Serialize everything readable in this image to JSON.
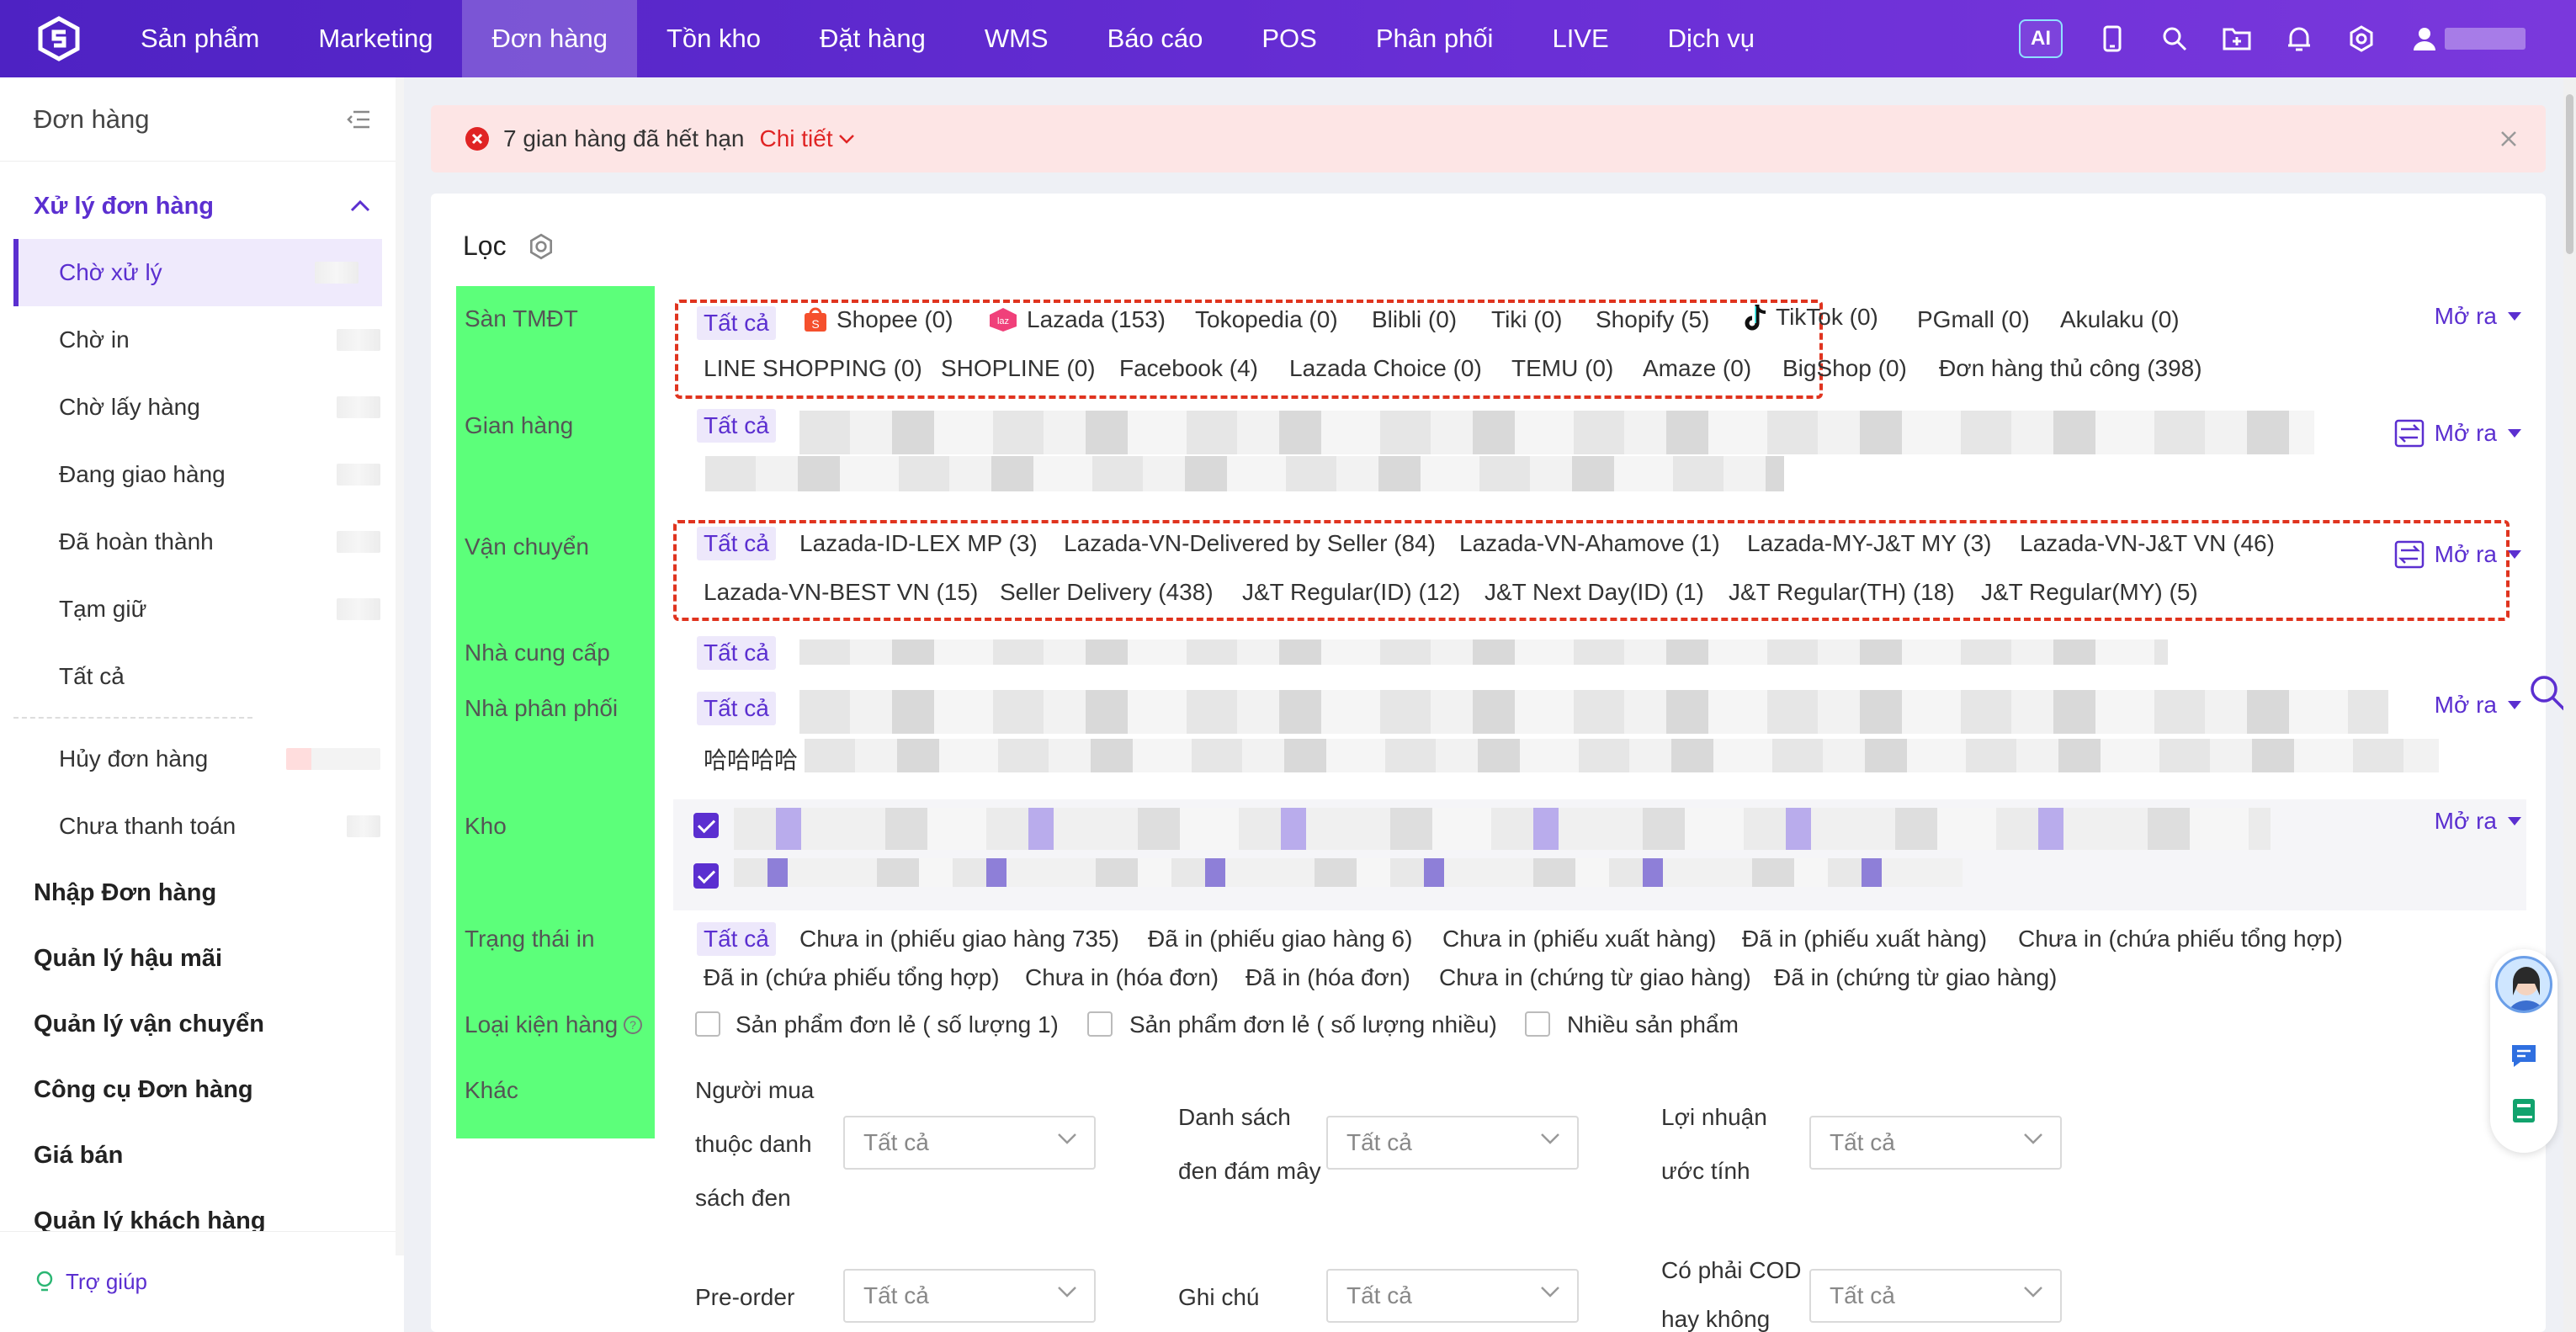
{
  "nav": {
    "items": [
      "Sản phẩm",
      "Marketing",
      "Đơn hàng",
      "Tồn kho",
      "Đặt hàng",
      "WMS",
      "Báo cáo",
      "POS",
      "Phân phối",
      "LIVE",
      "Dịch vụ"
    ],
    "active_index": 2,
    "ai_label": "AI",
    "icons": [
      "mobile-icon",
      "search-icon",
      "folder-icon",
      "bell-icon",
      "gear-icon",
      "user-icon"
    ]
  },
  "sidebar": {
    "title": "Đơn hàng",
    "group_open": "Xử lý đơn hàng",
    "items": [
      "Chờ xử lý",
      "Chờ in",
      "Chờ lấy hàng",
      "Đang giao hàng",
      "Đã hoàn thành",
      "Tạm giữ",
      "Tất cả"
    ],
    "items2": [
      "Hủy đơn hàng",
      "Chưa thanh toán"
    ],
    "groups": [
      "Nhập Đơn hàng",
      "Quản lý hậu mãi",
      "Quản lý vận chuyển",
      "Công cụ Đơn hàng",
      "Giá bán",
      "Quản lý khách hàng"
    ],
    "help": "Trợ giúp"
  },
  "alert": {
    "text": "7 gian hàng đã hết hạn",
    "link": "Chi tiết"
  },
  "filter": {
    "title": "Lọc",
    "expand": "Mở ra",
    "all": "Tất cả",
    "labels": {
      "marketplace": "Sàn TMĐT",
      "store": "Gian hàng",
      "shipping": "Vận chuyển",
      "supplier": "Nhà cung cấp",
      "distributor": "Nhà phân phối",
      "warehouse": "Kho",
      "print_status": "Trạng thái in",
      "package_type": "Loại kiện hàng",
      "other": "Khác"
    },
    "marketplace_row1": [
      "Shopee (0)",
      "Lazada (153)",
      "Tokopedia (0)",
      "Blibli (0)",
      "Tiki (0)",
      "Shopify (5)",
      "TikTok (0)",
      "PGmall (0)",
      "Akulaku (0)"
    ],
    "marketplace_row2": [
      "LINE SHOPPING (0)",
      "SHOPLINE (0)",
      "Facebook (4)",
      "Lazada Choice (0)",
      "TEMU (0)",
      "Amaze (0)",
      "BigShop (0)",
      "Đơn hàng thủ công (398)"
    ],
    "shipping_row1": [
      "Lazada-ID-LEX MP (3)",
      "Lazada-VN-Delivered by Seller (84)",
      "Lazada-VN-Ahamove (1)",
      "Lazada-MY-J&T MY (3)",
      "Lazada-VN-J&T VN (46)"
    ],
    "shipping_row2": [
      "Lazada-VN-BEST VN (15)",
      "Seller Delivery (438)",
      "J&T Regular(ID) (12)",
      "J&T Next Day(ID) (1)",
      "J&T Regular(TH) (18)",
      "J&T Regular(MY) (5)"
    ],
    "distributor_text": "哈哈哈哈",
    "print_row1": [
      "Chưa in (phiếu giao hàng 735)",
      "Đã in (phiếu giao hàng 6)",
      "Chưa in (phiếu xuất hàng)",
      "Đã in (phiếu xuất hàng)",
      "Chưa in (chứa phiếu tổng hợp)"
    ],
    "print_row2": [
      "Đã in (chứa phiếu tổng hợp)",
      "Chưa in (hóa đơn)",
      "Đã in (hóa đơn)",
      "Chưa in (chứng từ giao hàng)",
      "Đã in (chứng từ giao hàng)"
    ],
    "package_options": [
      "Sản phẩm đơn lẻ ( số lượng 1)",
      "Sản phẩm đơn lẻ ( số lượng nhiều)",
      "Nhiều sản phẩm"
    ],
    "other": {
      "blacklist_label": [
        "Người mua",
        "thuộc danh",
        "sách đen"
      ],
      "cloud_blacklist_label": [
        "Danh sách",
        "đen đám mây"
      ],
      "profit_label": [
        "Lợi nhuận",
        "ước tính"
      ],
      "preorder_label": "Pre-order",
      "note_label": "Ghi chú",
      "cod_label": [
        "Có phải COD",
        "hay không"
      ],
      "select_value": "Tất cả"
    }
  }
}
